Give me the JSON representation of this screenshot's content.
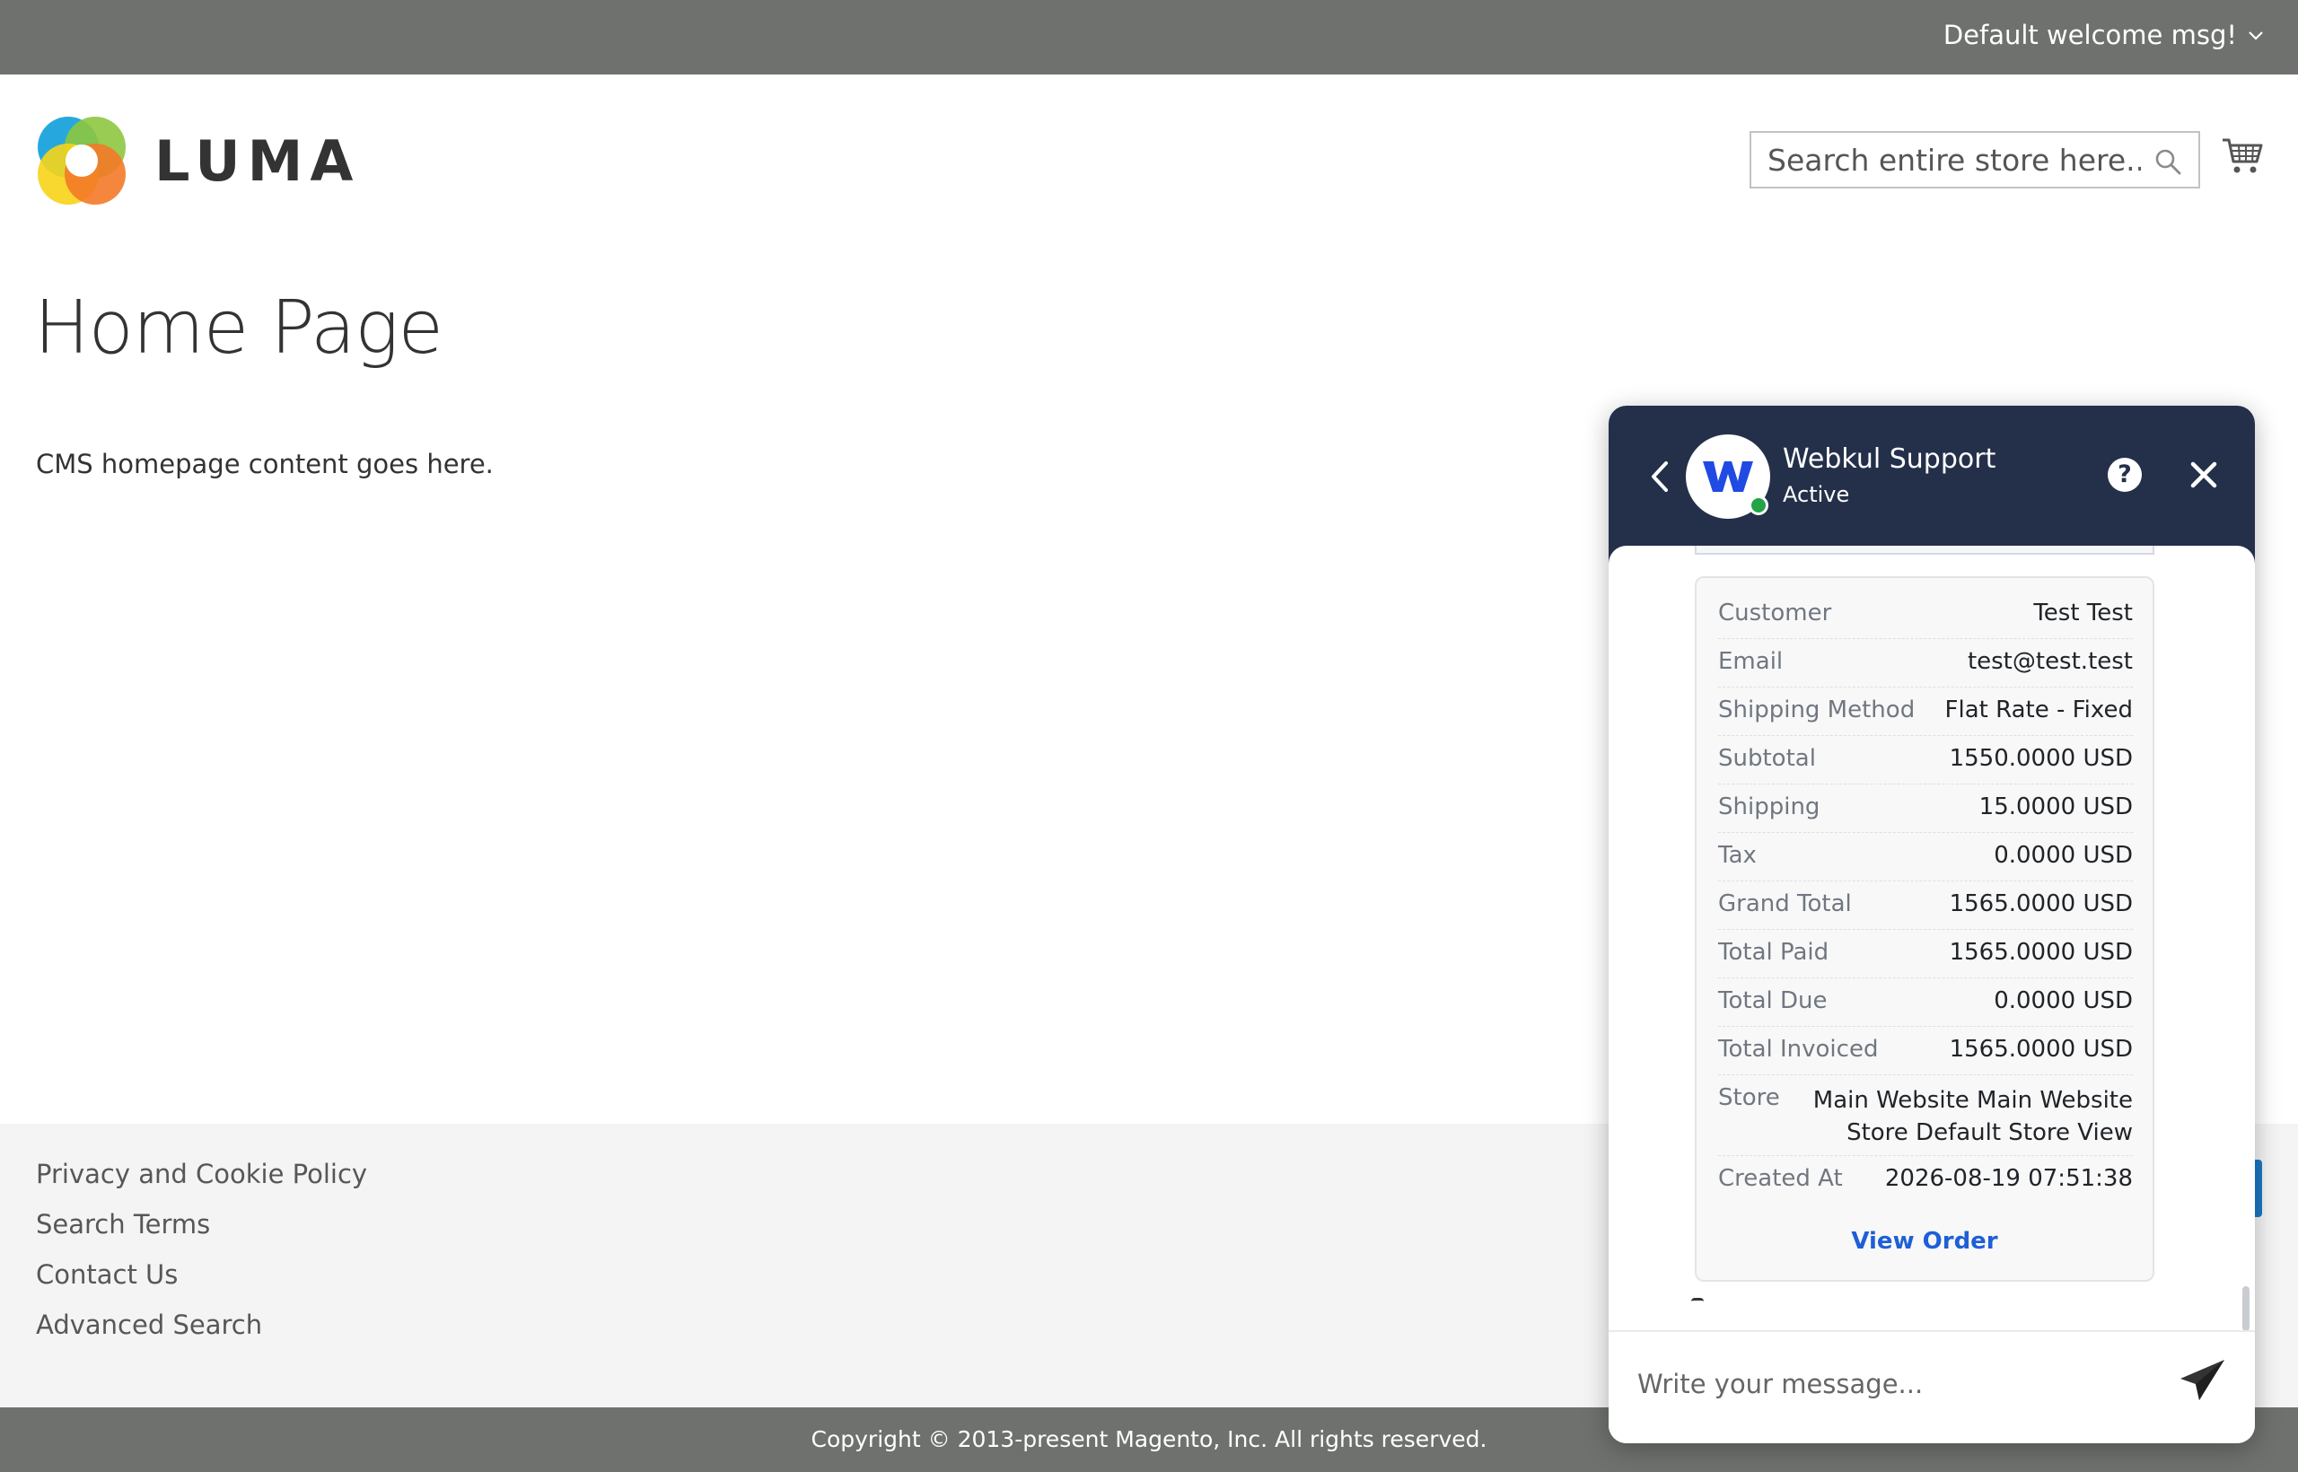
{
  "header": {
    "welcome_text": "Default welcome msg!",
    "logo_text": "LUMA",
    "search_placeholder": "Search entire store here...",
    "search_icon": "search-icon",
    "cart_icon": "cart-icon"
  },
  "main": {
    "title": "Home Page",
    "content": "CMS homepage content goes here."
  },
  "footer": {
    "links": [
      "Privacy and Cookie Policy",
      "Search Terms",
      "Contact Us",
      "Advanced Search"
    ],
    "copyright": "Copyright © 2013-present Magento, Inc. All rights reserved."
  },
  "chat": {
    "agent_name": "Webkul Support",
    "status": "Active",
    "help_label": "?",
    "order": {
      "rows": [
        {
          "label": "Customer",
          "value": "Test Test"
        },
        {
          "label": "Email",
          "value": "test@test.test"
        },
        {
          "label": "Shipping Method",
          "value": "Flat Rate - Fixed"
        },
        {
          "label": "Subtotal",
          "value": "1550.0000 USD"
        },
        {
          "label": "Shipping",
          "value": "15.0000 USD"
        },
        {
          "label": "Tax",
          "value": "0.0000 USD"
        },
        {
          "label": "Grand Total",
          "value": "1565.0000 USD"
        },
        {
          "label": "Total Paid",
          "value": "1565.0000 USD"
        },
        {
          "label": "Total Due",
          "value": "0.0000 USD"
        },
        {
          "label": "Total Invoiced",
          "value": "1565.0000 USD"
        },
        {
          "label": "Store",
          "value": "Main Website Main Website Store Default Store View"
        },
        {
          "label": "Created At",
          "value": "2026-08-19 07:51:38"
        }
      ],
      "view_order_label": "View Order"
    },
    "input_placeholder": "Write your message..."
  },
  "colors": {
    "top_bar": "#6e716e",
    "chat_header": "#24304a",
    "link_blue": "#1f5fd6",
    "status_green": "#22a447"
  }
}
